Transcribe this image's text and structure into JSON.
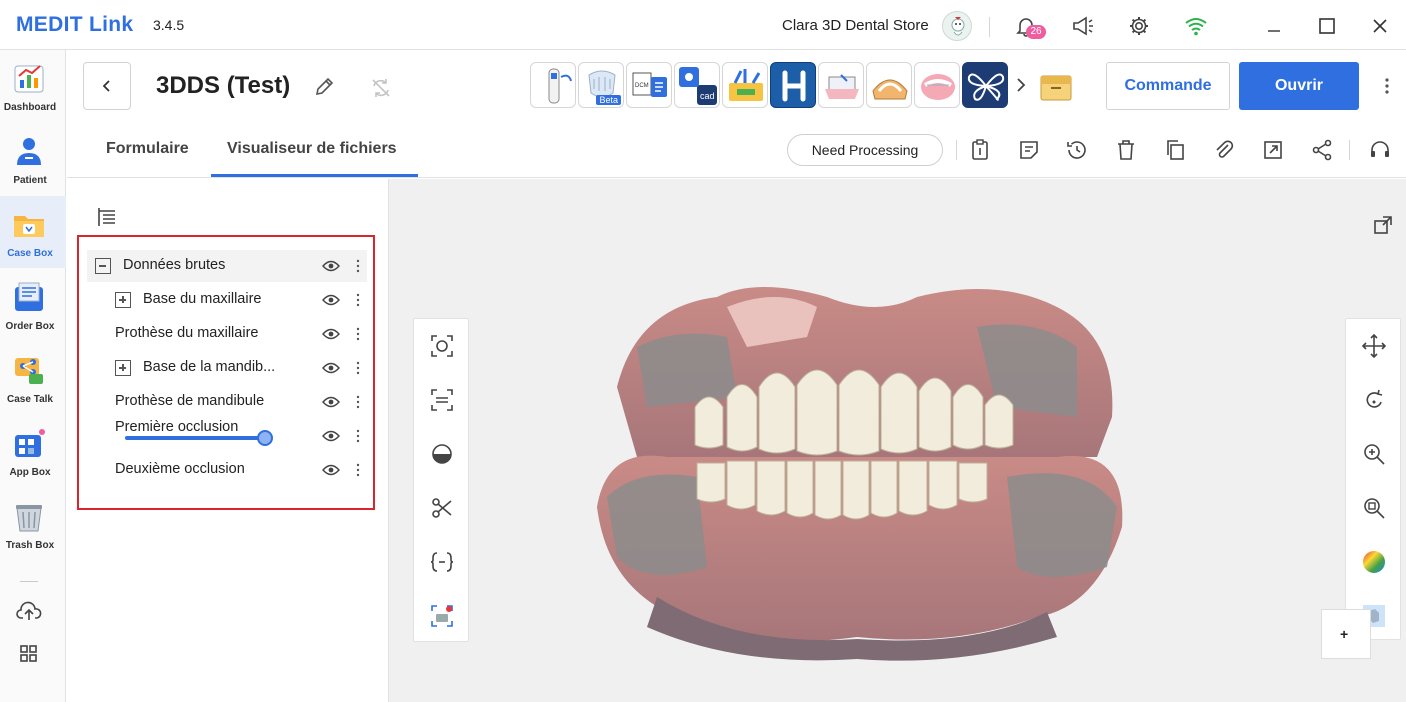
{
  "titlebar": {
    "brand": "MEDIT Link",
    "version": "3.4.5",
    "store_name": "Clara 3D Dental Store",
    "notification_count": "26",
    "icons": [
      "bell-icon",
      "megaphone-icon",
      "gear-icon",
      "wifi-icon",
      "minimize-icon",
      "maximize-icon",
      "close-icon"
    ]
  },
  "sidebar": {
    "items": [
      {
        "label": "Dashboard",
        "icon": "dashboard-icon"
      },
      {
        "label": "Patient",
        "icon": "patient-icon"
      },
      {
        "label": "Case Box",
        "icon": "case-box-icon",
        "active": true
      },
      {
        "label": "Order Box",
        "icon": "order-box-icon"
      },
      {
        "label": "Case Talk",
        "icon": "case-talk-icon"
      },
      {
        "label": "App Box",
        "icon": "app-box-icon"
      },
      {
        "label": "Trash Box",
        "icon": "trash-box-icon"
      }
    ]
  },
  "header": {
    "case_title": "3DDS (Test)",
    "beta_label": "Beta",
    "commande_label": "Commande",
    "ouvrir_label": "Ouvrir",
    "tabs": [
      {
        "label": "Formulaire"
      },
      {
        "label": "Visualiseur de fichiers",
        "active": true
      }
    ],
    "status_button": "Need Processing"
  },
  "tree": {
    "rows": [
      {
        "label": "Données brutes",
        "toggle": "minus",
        "selected": true
      },
      {
        "label": "Base du maxillaire",
        "toggle": "plus"
      },
      {
        "label": "Prothèse du maxillaire"
      },
      {
        "label": "Base de la mandib...",
        "toggle": "plus"
      },
      {
        "label": "Prothèse de mandibule"
      },
      {
        "label": "Première occlusion",
        "slider_fraction": 1.0
      },
      {
        "label": "Deuxième occlusion"
      }
    ]
  },
  "colors": {
    "accent": "#2f6fe0",
    "highlight_border": "#d9262c",
    "viewer_bg": "#f0f0f0"
  }
}
